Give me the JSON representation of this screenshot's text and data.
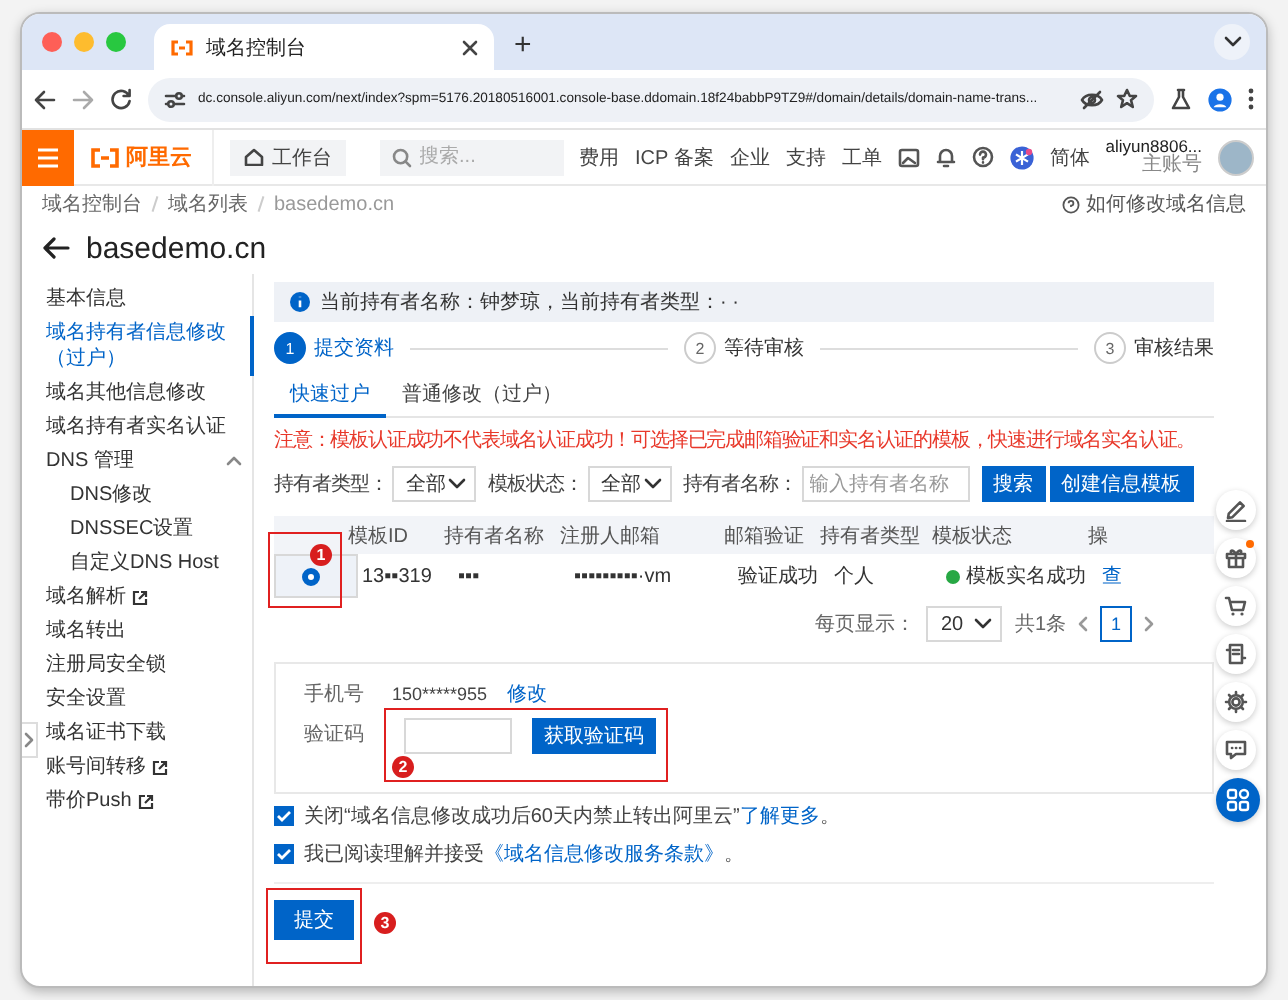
{
  "browser": {
    "tab": {
      "title": "域名控制台"
    },
    "new_tab": "+",
    "url": "dc.console.aliyun.com/next/index?spm=5176.20180516001.console-base.ddomain.18f24babbP9TZ9#/domain/details/domain-name-trans..."
  },
  "topbar": {
    "logo": "阿里云",
    "workbench": "工作台",
    "search": {
      "placeholder": "搜索..."
    },
    "nav": [
      "费用",
      "ICP 备案",
      "企业",
      "支持",
      "工单"
    ],
    "language": "简体",
    "user": {
      "name": "aliyun8806...",
      "role": "主账号"
    }
  },
  "breadcrumb": [
    "域名控制台",
    "域名列表",
    "basedemo.cn"
  ],
  "help_link": "如何修改域名信息",
  "title": "basedemo.cn",
  "sidebar": {
    "items": [
      {
        "label": "基本信息",
        "selected": false,
        "external": false
      },
      {
        "label": "域名持有者信息修改（过户）",
        "selected": true,
        "external": false
      },
      {
        "label": "域名其他信息修改",
        "selected": false,
        "external": false
      },
      {
        "label": "域名持有者实名认证",
        "selected": false,
        "external": false
      },
      {
        "label": "DNS 管理",
        "selected": false,
        "external": false,
        "expanded": true,
        "children": [
          {
            "label": "DNS修改",
            "selected": false,
            "external": false
          },
          {
            "label": "DNSSEC设置",
            "selected": false,
            "external": false
          },
          {
            "label": "自定义DNS Host",
            "selected": false,
            "external": false
          }
        ]
      },
      {
        "label": "域名解析",
        "selected": false,
        "external": true
      },
      {
        "label": "域名转出",
        "selected": false,
        "external": false
      },
      {
        "label": "注册局安全锁",
        "selected": false,
        "external": false
      },
      {
        "label": "安全设置",
        "selected": false,
        "external": false
      },
      {
        "label": "域名证书下载",
        "selected": false,
        "external": false
      },
      {
        "label": "账号间转移",
        "selected": false,
        "external": true
      },
      {
        "label": "带价Push",
        "selected": false,
        "external": true
      }
    ]
  },
  "info": "当前持有者名称：钟梦琼，当前持有者类型：· ·",
  "steps": [
    {
      "number": "1",
      "label": "提交资料",
      "active": true
    },
    {
      "number": "2",
      "label": "等待审核",
      "active": false
    },
    {
      "number": "3",
      "label": "审核结果",
      "active": false
    }
  ],
  "tabs": [
    {
      "label": "快速过户",
      "selected": true
    },
    {
      "label": "普通修改（过户）",
      "selected": false
    }
  ],
  "notice": "注意：模板认证成功不代表域名认证成功！可选择已完成邮箱验证和实名认证的模板，快速进行域名实名认证。",
  "filters": [
    {
      "kind": "select",
      "label": "持有者类型：",
      "value": "全部"
    },
    {
      "kind": "select",
      "label": "模板状态：",
      "value": "全部"
    },
    {
      "kind": "input",
      "label": "持有者名称：",
      "placeholder": "输入持有者名称"
    }
  ],
  "filter_buttons": [
    "搜索",
    "创建信息模板"
  ],
  "table": {
    "columns": [
      "模板ID",
      "持有者名称",
      "注册人邮箱",
      "邮箱验证",
      "持有者类型",
      "模板状态",
      "操"
    ],
    "rows": [
      {
        "selected": true,
        "cells": [
          "13▪▪319",
          "▪▪▪",
          "▪▪▪▪▪▪▪▪▪·vm",
          "验证成功",
          "个人"
        ],
        "status": {
          "text": "模板实名成功",
          "color": "#27a844"
        },
        "action": "查"
      }
    ]
  },
  "pagination": {
    "page_size_label": "每页显示：",
    "page_size": "20",
    "total": "共1条",
    "pages": [
      {
        "label": "1",
        "selected": true
      }
    ]
  },
  "verification": {
    "phone_label": "手机号",
    "phone": "150*****955",
    "edit": "修改",
    "code_label": "验证码",
    "get_code": "获取验证码"
  },
  "agreements": [
    {
      "checked": true,
      "text": "关闭“域名信息修改成功后60天内禁止转出阿里云”",
      "link": "了解更多",
      "suffix": "。"
    },
    {
      "checked": true,
      "text": "我已阅读理解并接受",
      "link": "《域名信息修改服务条款》",
      "suffix": "。"
    }
  ],
  "submit": "提交",
  "annotations": [
    {
      "number": "1"
    },
    {
      "number": "2"
    },
    {
      "number": "3"
    }
  ]
}
